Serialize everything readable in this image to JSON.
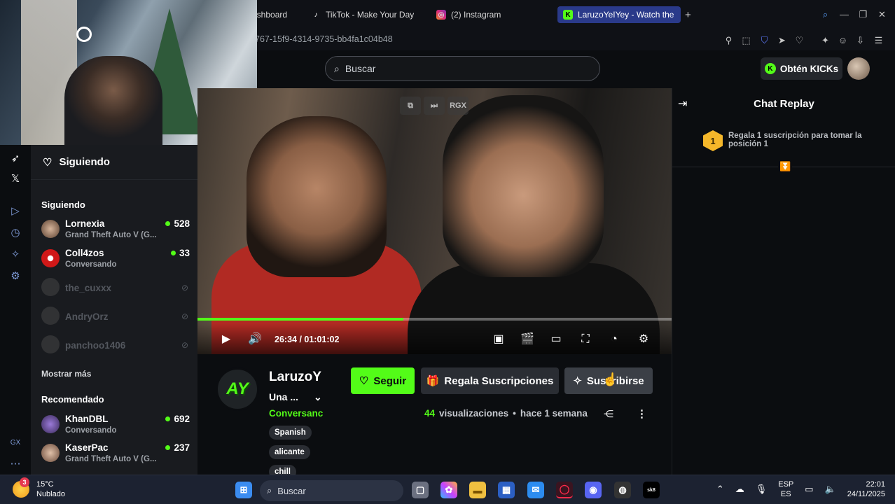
{
  "browser": {
    "tabs": [
      {
        "label": "ashboard",
        "icon": "dashboard-icon",
        "active": false
      },
      {
        "label": "TikTok - Make Your Day",
        "icon": "tiktok-icon",
        "active": false
      },
      {
        "label": "(2) Instagram",
        "icon": "instagram-icon",
        "active": false
      },
      {
        "label": "LaruzoYeIYey - Watch the",
        "icon": "kick-icon",
        "active": true
      }
    ],
    "new_tab": "+",
    "url": "767-15f9-4314-9735-bb4fa1c04b48"
  },
  "header": {
    "search_placeholder": "Buscar",
    "kicks_label": "Obtén KICKs"
  },
  "sidebar": {
    "following_header": "Siguiendo",
    "section_following": "Siguiendo",
    "following": [
      {
        "name": "Lornexia",
        "sub": "Grand Theft Auto V (G...",
        "viewers": "528",
        "live": true
      },
      {
        "name": "Coll4zos",
        "sub": "Conversando",
        "viewers": "33",
        "live": true
      },
      {
        "name": "the_cuxxx",
        "sub": "",
        "viewers": "",
        "live": false
      },
      {
        "name": "AndryOrz",
        "sub": "",
        "viewers": "",
        "live": false
      },
      {
        "name": "panchoo1406",
        "sub": "",
        "viewers": "",
        "live": false
      }
    ],
    "show_more": "Mostrar más",
    "section_recommended": "Recomendado",
    "recommended": [
      {
        "name": "KhanDBL",
        "sub": "Conversando",
        "viewers": "692",
        "live": true
      },
      {
        "name": "KaserPac",
        "sub": "Grand Theft Auto V (G...",
        "viewers": "237",
        "live": true
      }
    ]
  },
  "player": {
    "top_icons": [
      "pip-icon",
      "skip-icon",
      "RGX"
    ],
    "time": "26:34 / 01:01:02",
    "progress": 0.434
  },
  "chat": {
    "title": "Chat Replay",
    "gift_rank": "1",
    "gift_text": "Regala 1 suscripción para tomar la posición 1"
  },
  "channel": {
    "logo_text": "AY",
    "name": "LaruzoY",
    "title": "Una ...",
    "category": "Conversanc",
    "tags": [
      "Spanish",
      "alicante",
      "chill"
    ],
    "follow_label": "Seguir",
    "gift_subs_label": "Regala Suscripciones",
    "subscribe_label": "Suscribirse",
    "views_count": "44",
    "views_label": "visualizaciones",
    "separator": "•",
    "ago": "hace 1 semana"
  },
  "taskbar": {
    "weather_badge": "3",
    "temperature": "15°C",
    "condition": "Nublado",
    "search_placeholder": "Buscar",
    "lang_top": "ESP",
    "lang_bottom": "ES",
    "time": "22:01",
    "date": "24/11/2025"
  },
  "colors": {
    "accent": "#53fc18",
    "background": "#0b0d10",
    "sidebar": "#191b1f",
    "active_tab": "#2a3a8a"
  }
}
